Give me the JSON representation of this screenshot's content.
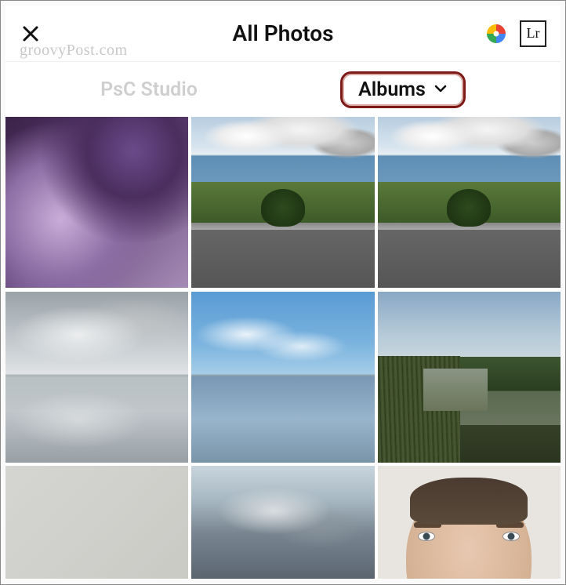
{
  "header": {
    "title": "All Photos",
    "lr_label": "Lr"
  },
  "watermark": "groovyPost.com",
  "tabs": {
    "inactive": "PsC Studio",
    "active": "Albums"
  },
  "grid": {
    "items": [
      {
        "name": "photo-purple-abstract"
      },
      {
        "name": "photo-street-trees-1"
      },
      {
        "name": "photo-street-trees-2"
      },
      {
        "name": "photo-grey-lake"
      },
      {
        "name": "photo-blue-lake"
      },
      {
        "name": "photo-river-reeds"
      },
      {
        "name": "photo-blank-grey"
      },
      {
        "name": "photo-cloudy-sky"
      },
      {
        "name": "photo-selfie-face"
      }
    ]
  }
}
